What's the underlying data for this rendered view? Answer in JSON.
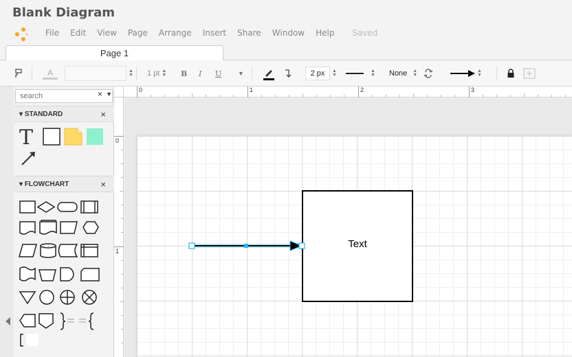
{
  "app": {
    "title": "Blank Diagram",
    "menu": [
      "File",
      "Edit",
      "View",
      "Page",
      "Arrange",
      "Insert",
      "Share",
      "Window",
      "Help"
    ],
    "save_status": "Saved",
    "colors": {
      "accent": "#f5a623",
      "selection": "#29b6f2"
    }
  },
  "tabs": {
    "page1": "Page 1"
  },
  "toolbar": {
    "font_color_glyph": "A",
    "font_size": "1 pt",
    "bold": "B",
    "italic": "I",
    "underline": "U",
    "line_width": "2 px",
    "line_end_start": "None"
  },
  "sidebar": {
    "search_placeholder": "search",
    "search_clear": "×",
    "sections": [
      {
        "title": "STANDARD",
        "close": "×"
      },
      {
        "title": "FLOWCHART",
        "close": "×"
      }
    ]
  },
  "rulers": {
    "top": [
      "0",
      "1",
      "2",
      "3"
    ],
    "left": [
      "0",
      "1"
    ]
  },
  "canvas": {
    "shape_label": "Text"
  }
}
